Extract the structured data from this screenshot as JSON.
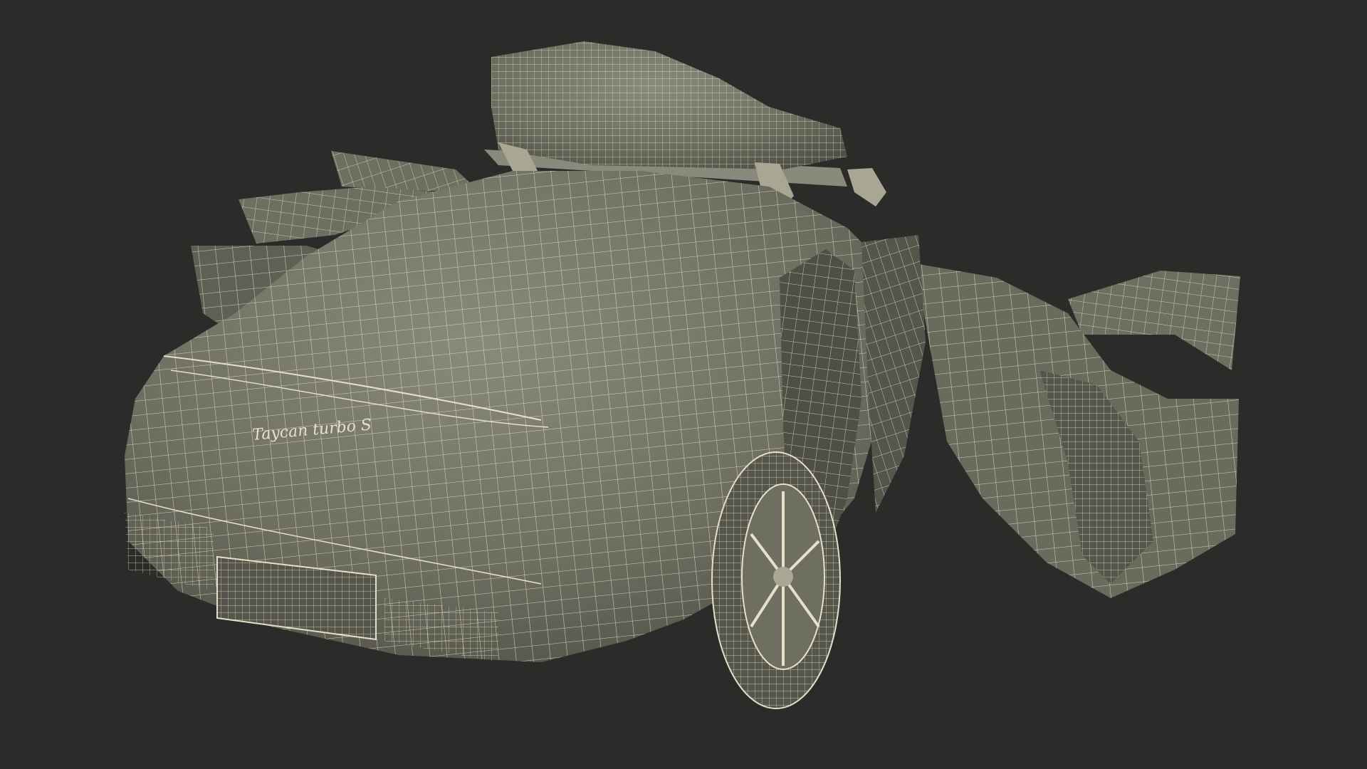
{
  "scene": {
    "background": "#2b2b2a",
    "mesh_fill": "#6e6e61",
    "mesh_fill_dark": "#4f4f45",
    "mesh_fill_light": "#8a8a7c",
    "wire_color": "#e4e1c8",
    "badge_text": "Taycan turbo S"
  }
}
